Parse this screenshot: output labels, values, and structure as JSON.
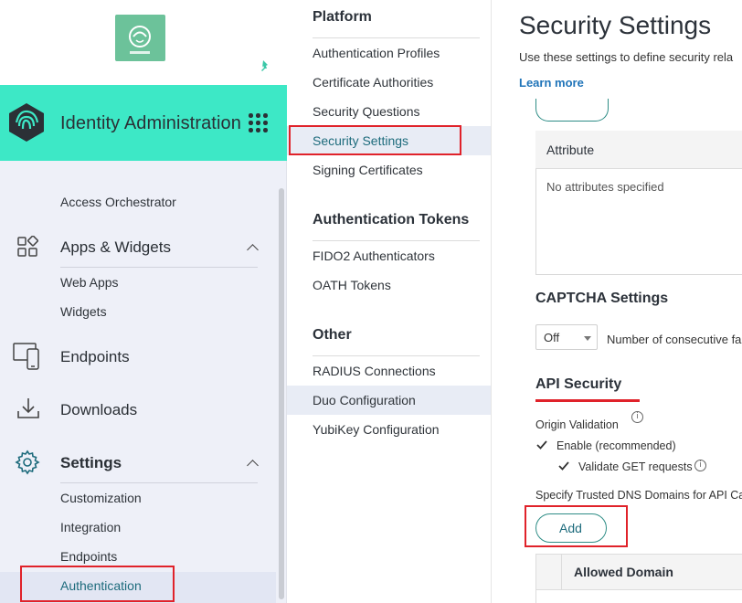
{
  "sidebar": {
    "title": "Identity Administration",
    "items": [
      {
        "label": "Access Orchestrator"
      },
      {
        "label": "Apps & Widgets"
      },
      {
        "label": "Web Apps"
      },
      {
        "label": "Widgets"
      },
      {
        "label": "Endpoints"
      },
      {
        "label": "Downloads"
      },
      {
        "label": "Settings"
      },
      {
        "label": "Customization"
      },
      {
        "label": "Integration"
      },
      {
        "label": "Endpoints"
      },
      {
        "label": "Authentication"
      }
    ]
  },
  "subnav": {
    "sections": [
      {
        "title": "Platform",
        "items": [
          "Authentication Profiles",
          "Certificate Authorities",
          "Security Questions",
          "Security Settings",
          "Signing Certificates"
        ]
      },
      {
        "title": "Authentication Tokens",
        "items": [
          "FIDO2 Authenticators",
          "OATH Tokens"
        ]
      },
      {
        "title": "Other",
        "items": [
          "RADIUS Connections",
          "Duo Configuration",
          "YubiKey Configuration"
        ]
      }
    ]
  },
  "main": {
    "title": "Security Settings",
    "subtitle": "Use these settings to define security rela",
    "learn_more": "Learn more",
    "attribute_header": "Attribute",
    "attribute_empty": "No attributes specified",
    "captcha_title": "CAPTCHA Settings",
    "captcha_select": "Off",
    "captcha_label": "Number of consecutive fai",
    "api_title": "API Security",
    "origin_validation": "Origin Validation",
    "enable_label": "Enable (recommended)",
    "validate_get_label": "Validate GET requests",
    "trusted_dns_label": "Specify Trusted DNS Domains for API Cal",
    "add_button": "Add",
    "allowed_domain_header": "Allowed Domain"
  },
  "colors": {
    "banner": "#3de8c6",
    "accent": "#1d6b7c",
    "highlight": "#e0222a",
    "link": "#1e73b8"
  }
}
